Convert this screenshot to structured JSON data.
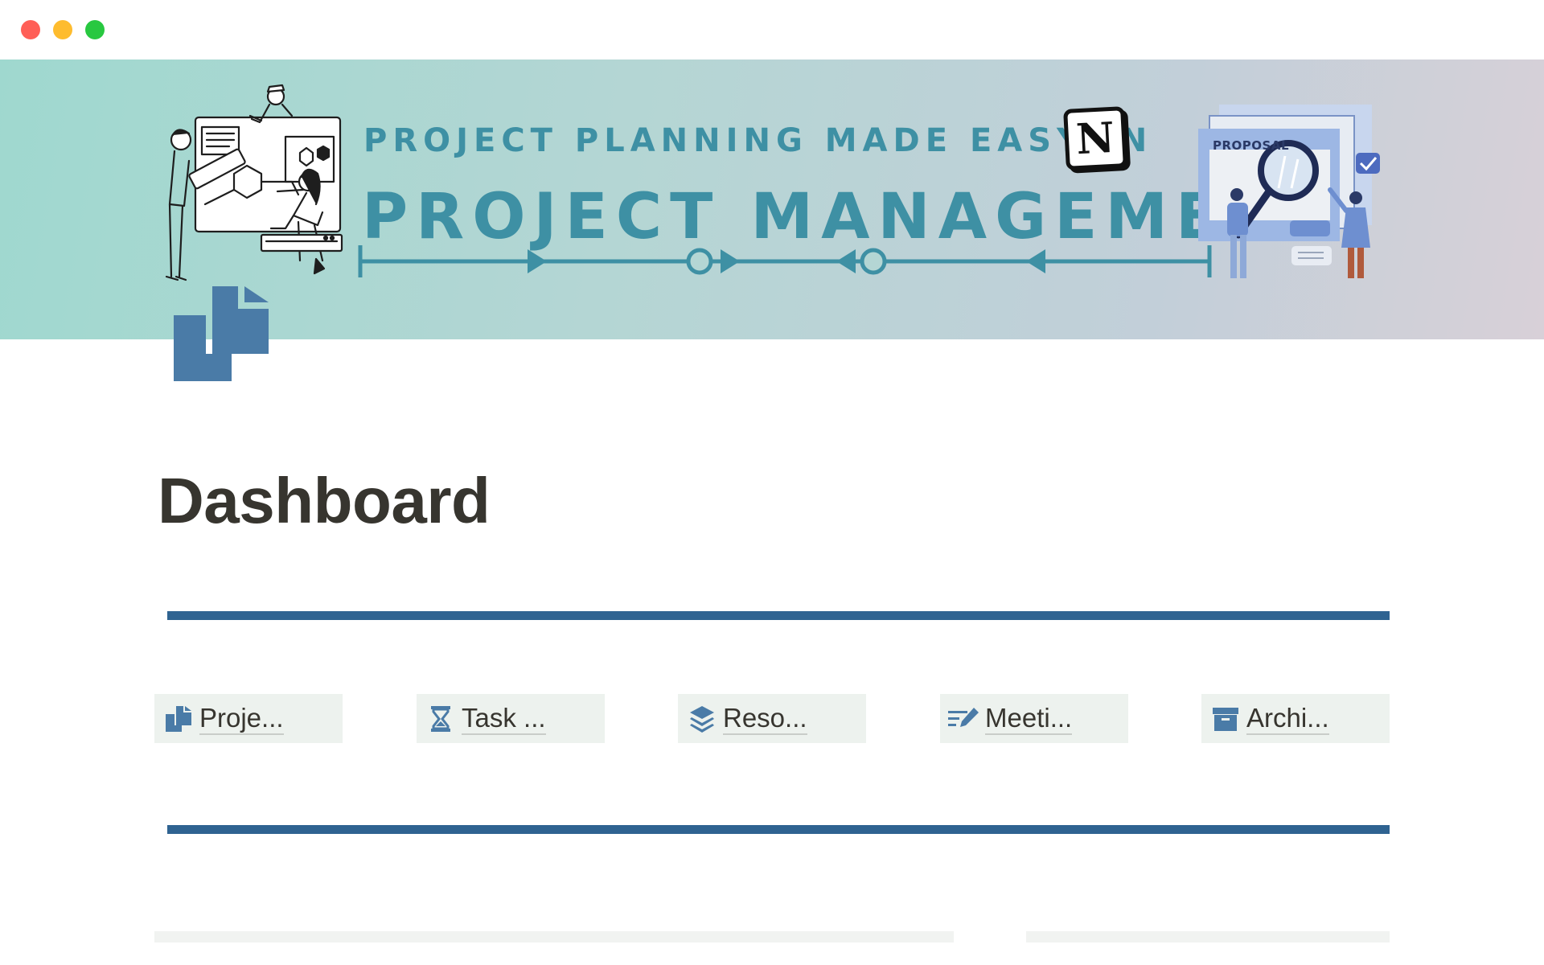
{
  "window": {
    "controls": [
      "close",
      "minimize",
      "zoom"
    ]
  },
  "cover": {
    "headline": "PROJECT PLANNING MADE EASY IN",
    "logo_letter": "N",
    "title": "PROJECT MANAGEMENT",
    "proposal_label": "PROPOSAL",
    "colors": {
      "text": "#3e90a4",
      "gradient_start": "#9fd8cf",
      "gradient_end": "#d8d0d8"
    }
  },
  "page": {
    "icon": "documents-icon",
    "title": "Dashboard"
  },
  "divider_color": "#2f6391",
  "links": [
    {
      "label": "Proje...",
      "icon": "documents-icon"
    },
    {
      "label": "Task ...",
      "icon": "hourglass-icon"
    },
    {
      "label": "Reso...",
      "icon": "layers-icon"
    },
    {
      "label": "Meeti...",
      "icon": "edit-list-icon"
    },
    {
      "label": "Archi...",
      "icon": "archive-box-icon"
    }
  ],
  "link_bg": "#edf2ee",
  "accent": "#4a7ba7"
}
